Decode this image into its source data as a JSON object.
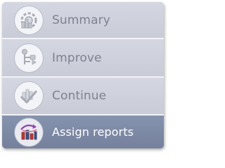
{
  "menu": {
    "items": [
      {
        "label": "Summary",
        "icon": "summary-chart-gear-icon",
        "selected": false
      },
      {
        "label": "Improve",
        "icon": "improve-flow-icon",
        "selected": false
      },
      {
        "label": "Continue",
        "icon": "continue-check-icon",
        "selected": false
      },
      {
        "label": "Assign reports",
        "icon": "assign-reports-icon",
        "selected": true
      }
    ]
  },
  "colors": {
    "item_background": "#cfd2dc",
    "selected_background": "#7f8ba6",
    "label_text": "#7e8190",
    "selected_label_text": "#ffffff"
  }
}
